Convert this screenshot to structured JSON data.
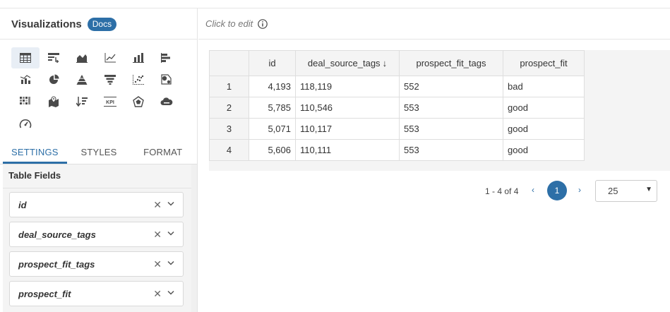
{
  "sidebar": {
    "title": "Visualizations",
    "docs_label": "Docs",
    "vis_icons": [
      "table-icon",
      "pivot-table-icon",
      "area-chart-icon",
      "line-chart-icon",
      "bar-chart-icon",
      "horizontal-bar-chart-icon",
      "combo-chart-icon",
      "pie-chart-icon",
      "pyramid-chart-icon",
      "funnel-chart-icon",
      "scatter-plot-icon",
      "bubble-map-icon",
      "heatmap-icon",
      "map-marker-icon",
      "sort-list-icon",
      "kpi-icon",
      "polygon-map-icon",
      "cloud-icon",
      "gauge-icon"
    ],
    "tabs": {
      "settings": "SETTINGS",
      "styles": "STYLES",
      "format": "FORMAT"
    },
    "panel_title": "Table Fields",
    "fields": [
      {
        "name": "id",
        "remove": "✕"
      },
      {
        "name": "deal_source_tags",
        "remove": "✕"
      },
      {
        "name": "prospect_fit_tags",
        "remove": "✕"
      },
      {
        "name": "prospect_fit",
        "remove": "✕"
      }
    ]
  },
  "main": {
    "click_to_edit": "Click to edit",
    "table": {
      "columns": [
        "id",
        "deal_source_tags",
        "prospect_fit_tags",
        "prospect_fit"
      ],
      "sort_indicator": "↓",
      "rows": [
        {
          "n": "1",
          "id": "4,193",
          "deal_source_tags": "118,119",
          "prospect_fit_tags": "552",
          "prospect_fit": "bad"
        },
        {
          "n": "2",
          "id": "5,785",
          "deal_source_tags": "110,546",
          "prospect_fit_tags": "553",
          "prospect_fit": "good"
        },
        {
          "n": "3",
          "id": "5,071",
          "deal_source_tags": "110,117",
          "prospect_fit_tags": "553",
          "prospect_fit": "good"
        },
        {
          "n": "4",
          "id": "5,606",
          "deal_source_tags": "110,111",
          "prospect_fit_tags": "553",
          "prospect_fit": "good"
        }
      ]
    },
    "pager": {
      "range": "1 - 4 of 4",
      "prev": "‹",
      "page": "1",
      "next": "›",
      "page_size": "25",
      "caret": "▼"
    }
  },
  "colors": {
    "accent": "#2d6fa7",
    "icon": "#4a4a4a",
    "panel_bg": "#f4f4f4"
  }
}
